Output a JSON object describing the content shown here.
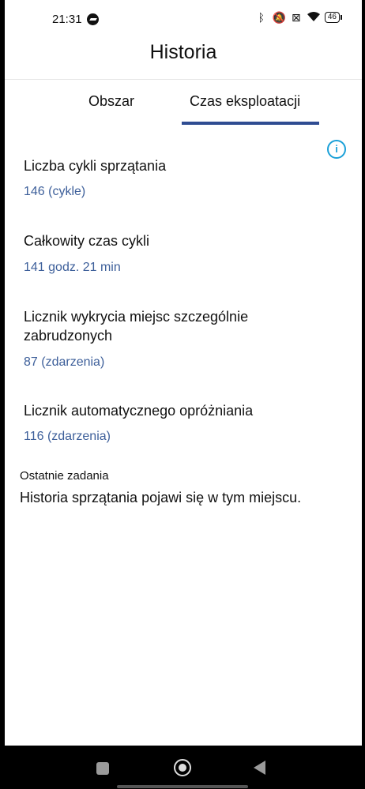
{
  "status_bar": {
    "time": "21:31",
    "battery": "46",
    "icons": [
      "messenger-icon",
      "bluetooth-icon",
      "vibrate-off-icon",
      "sim-off-icon",
      "wifi-icon",
      "battery-icon"
    ]
  },
  "header": {
    "title": "Historia"
  },
  "tabs": [
    {
      "label": "Obszar",
      "active": false
    },
    {
      "label": "Czas eksploatacji",
      "active": true
    }
  ],
  "stats": [
    {
      "title": "Liczba cykli sprzątania",
      "value": "146 (cykle)"
    },
    {
      "title": "Całkowity czas cykli",
      "value": "141 godz. 21 min"
    },
    {
      "title": "Licznik wykrycia miejsc szczególnie zabrudzonych",
      "value": "87 (zdarzenia)"
    },
    {
      "title": "Licznik automatycznego opróżniania",
      "value": "116 (zdarzenia)"
    }
  ],
  "recent": {
    "label": "Ostatnie zadania",
    "text": "Historia sprzątania pojawi się w tym miejscu."
  },
  "colors": {
    "accent": "#2f4c92",
    "value": "#3d5f9a",
    "info": "#1aa0d8"
  }
}
